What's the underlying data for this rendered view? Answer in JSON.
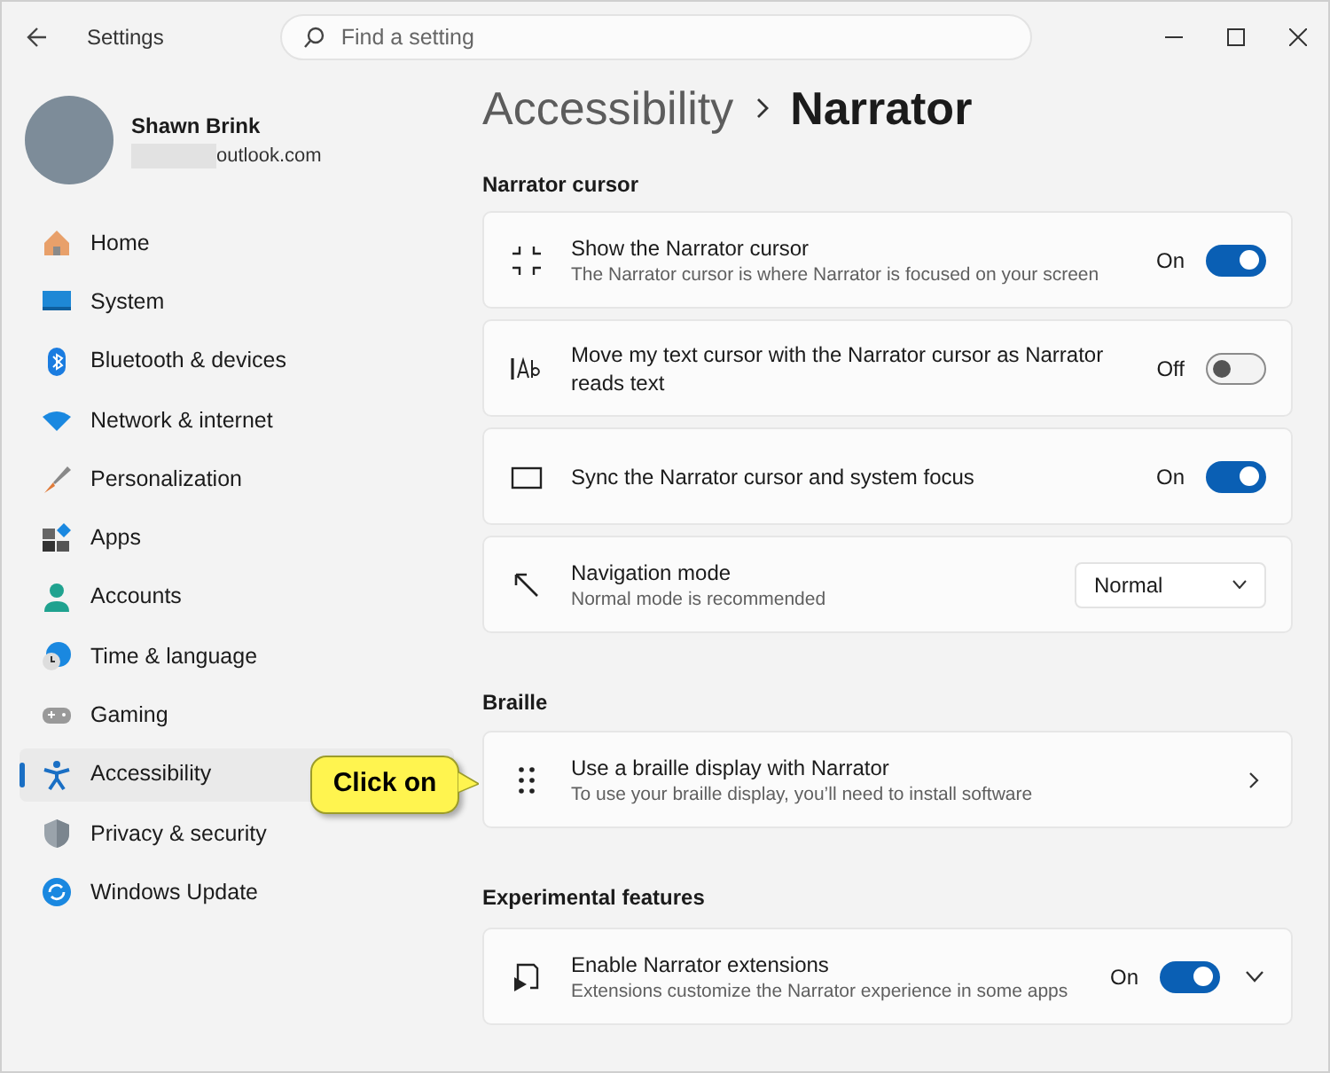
{
  "window": {
    "title": "Settings"
  },
  "search": {
    "placeholder": "Find a setting"
  },
  "user": {
    "name": "Shawn Brink",
    "email": "outlook.com"
  },
  "sidebar": {
    "items": [
      {
        "label": "Home",
        "selected": false
      },
      {
        "label": "System",
        "selected": false
      },
      {
        "label": "Bluetooth & devices",
        "selected": false
      },
      {
        "label": "Network & internet",
        "selected": false
      },
      {
        "label": "Personalization",
        "selected": false
      },
      {
        "label": "Apps",
        "selected": false
      },
      {
        "label": "Accounts",
        "selected": false
      },
      {
        "label": "Time & language",
        "selected": false
      },
      {
        "label": "Gaming",
        "selected": false
      },
      {
        "label": "Accessibility",
        "selected": true
      },
      {
        "label": "Privacy & security",
        "selected": false
      },
      {
        "label": "Windows Update",
        "selected": false
      }
    ]
  },
  "breadcrumb": [
    "Accessibility",
    "Narrator"
  ],
  "callout": {
    "text": "Click on"
  },
  "sections": [
    {
      "heading": "Narrator cursor",
      "rows": [
        {
          "kind": "toggle",
          "title": "Show the Narrator cursor",
          "description": "The Narrator cursor is where Narrator is focused on your screen",
          "on": true,
          "state_label": "On"
        },
        {
          "kind": "toggle",
          "title": "Move my text cursor with the Narrator cursor as Narrator reads text",
          "on": false,
          "state_label": "Off"
        },
        {
          "kind": "toggle",
          "title": "Sync the Narrator cursor and system focus",
          "on": true,
          "state_label": "On"
        },
        {
          "kind": "dropdown",
          "title": "Navigation mode",
          "description": "Normal mode is recommended",
          "value": "Normal"
        }
      ]
    },
    {
      "heading": "Braille",
      "rows": [
        {
          "kind": "link",
          "title": "Use a braille display with Narrator",
          "description": "To use your braille display, you’ll need to install software"
        }
      ]
    },
    {
      "heading": "Experimental features",
      "rows": [
        {
          "kind": "toggle",
          "title": "Enable Narrator extensions",
          "description": "Extensions customize the Narrator experience in some apps",
          "on": true,
          "state_label": "On",
          "expanded": false
        }
      ]
    }
  ]
}
